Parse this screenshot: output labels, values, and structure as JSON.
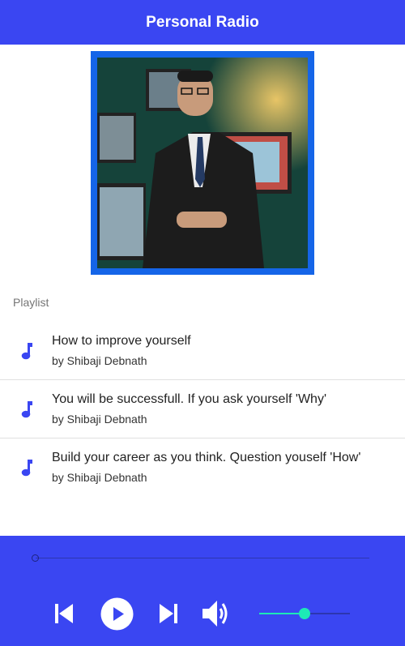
{
  "app": {
    "title": "Personal Radio"
  },
  "colors": {
    "primary": "#3a46f2",
    "cover_border": "#1565e8",
    "accent": "#1de9b6"
  },
  "playlist": {
    "label": "Playlist",
    "tracks": [
      {
        "title": "How to improve yourself",
        "artist": "by Shibaji Debnath",
        "icon": "music-note-icon"
      },
      {
        "title": "You will be successfull. If you ask yourself 'Why'",
        "artist": "by Shibaji Debnath",
        "icon": "music-note-icon"
      },
      {
        "title": "Build your career as you think. Question youself 'How'",
        "artist": "by Shibaji Debnath",
        "icon": "music-note-icon"
      }
    ]
  },
  "player": {
    "progress": 0,
    "volume": 0.5,
    "controls": [
      "skip-previous-icon",
      "play-icon",
      "skip-next-icon",
      "volume-up-icon"
    ]
  }
}
